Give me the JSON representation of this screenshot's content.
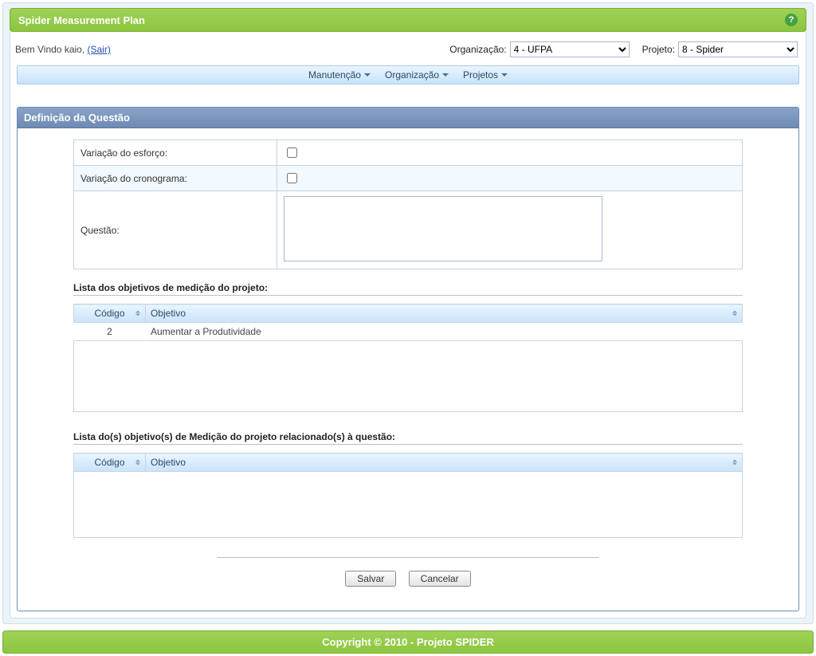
{
  "header": {
    "title": "Spider Measurement Plan"
  },
  "topline": {
    "welcome_prefix": "Bem Vindo kaio, ",
    "logout_text": "(Sair)",
    "org_label": "Organização:",
    "org_value": "4 - UFPA",
    "proj_label": "Projeto:",
    "proj_value": "8 - Spider"
  },
  "menu": {
    "items": [
      "Manutenção",
      "Organização",
      "Projetos"
    ]
  },
  "panel": {
    "title": "Definição da Questão",
    "form": {
      "row1_label": "Variação do esforço:",
      "row2_label": "Variação do cronograma:",
      "row3_label": "Questão:",
      "textarea_value": ""
    },
    "list1": {
      "title": "Lista dos objetivos de medição do projeto:",
      "cols": {
        "codigo": "Código",
        "objetivo": "Objetivo"
      },
      "rows": [
        {
          "codigo": "2",
          "objetivo": "Aumentar a Produtividade"
        }
      ]
    },
    "list2": {
      "title": "Lista do(s) objetivo(s) de Medição do projeto relacionado(s) à questão:",
      "cols": {
        "codigo": "Código",
        "objetivo": "Objetivo"
      },
      "rows": []
    },
    "buttons": {
      "save": "Salvar",
      "cancel": "Cancelar"
    }
  },
  "footer": {
    "text": "Copyright © 2010 - Projeto SPIDER"
  }
}
